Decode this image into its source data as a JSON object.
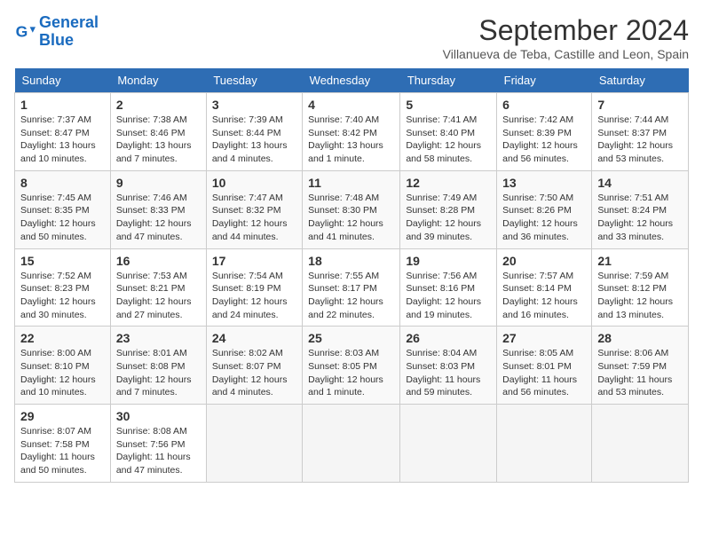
{
  "header": {
    "logo_line1": "General",
    "logo_line2": "Blue",
    "month_title": "September 2024",
    "location": "Villanueva de Teba, Castille and Leon, Spain"
  },
  "columns": [
    "Sunday",
    "Monday",
    "Tuesday",
    "Wednesday",
    "Thursday",
    "Friday",
    "Saturday"
  ],
  "weeks": [
    [
      {
        "day": "1",
        "sunrise": "7:37 AM",
        "sunset": "8:47 PM",
        "daylight": "13 hours and 10 minutes."
      },
      {
        "day": "2",
        "sunrise": "7:38 AM",
        "sunset": "8:46 PM",
        "daylight": "13 hours and 7 minutes."
      },
      {
        "day": "3",
        "sunrise": "7:39 AM",
        "sunset": "8:44 PM",
        "daylight": "13 hours and 4 minutes."
      },
      {
        "day": "4",
        "sunrise": "7:40 AM",
        "sunset": "8:42 PM",
        "daylight": "13 hours and 1 minute."
      },
      {
        "day": "5",
        "sunrise": "7:41 AM",
        "sunset": "8:40 PM",
        "daylight": "12 hours and 58 minutes."
      },
      {
        "day": "6",
        "sunrise": "7:42 AM",
        "sunset": "8:39 PM",
        "daylight": "12 hours and 56 minutes."
      },
      {
        "day": "7",
        "sunrise": "7:44 AM",
        "sunset": "8:37 PM",
        "daylight": "12 hours and 53 minutes."
      }
    ],
    [
      {
        "day": "8",
        "sunrise": "7:45 AM",
        "sunset": "8:35 PM",
        "daylight": "12 hours and 50 minutes."
      },
      {
        "day": "9",
        "sunrise": "7:46 AM",
        "sunset": "8:33 PM",
        "daylight": "12 hours and 47 minutes."
      },
      {
        "day": "10",
        "sunrise": "7:47 AM",
        "sunset": "8:32 PM",
        "daylight": "12 hours and 44 minutes."
      },
      {
        "day": "11",
        "sunrise": "7:48 AM",
        "sunset": "8:30 PM",
        "daylight": "12 hours and 41 minutes."
      },
      {
        "day": "12",
        "sunrise": "7:49 AM",
        "sunset": "8:28 PM",
        "daylight": "12 hours and 39 minutes."
      },
      {
        "day": "13",
        "sunrise": "7:50 AM",
        "sunset": "8:26 PM",
        "daylight": "12 hours and 36 minutes."
      },
      {
        "day": "14",
        "sunrise": "7:51 AM",
        "sunset": "8:24 PM",
        "daylight": "12 hours and 33 minutes."
      }
    ],
    [
      {
        "day": "15",
        "sunrise": "7:52 AM",
        "sunset": "8:23 PM",
        "daylight": "12 hours and 30 minutes."
      },
      {
        "day": "16",
        "sunrise": "7:53 AM",
        "sunset": "8:21 PM",
        "daylight": "12 hours and 27 minutes."
      },
      {
        "day": "17",
        "sunrise": "7:54 AM",
        "sunset": "8:19 PM",
        "daylight": "12 hours and 24 minutes."
      },
      {
        "day": "18",
        "sunrise": "7:55 AM",
        "sunset": "8:17 PM",
        "daylight": "12 hours and 22 minutes."
      },
      {
        "day": "19",
        "sunrise": "7:56 AM",
        "sunset": "8:16 PM",
        "daylight": "12 hours and 19 minutes."
      },
      {
        "day": "20",
        "sunrise": "7:57 AM",
        "sunset": "8:14 PM",
        "daylight": "12 hours and 16 minutes."
      },
      {
        "day": "21",
        "sunrise": "7:59 AM",
        "sunset": "8:12 PM",
        "daylight": "12 hours and 13 minutes."
      }
    ],
    [
      {
        "day": "22",
        "sunrise": "8:00 AM",
        "sunset": "8:10 PM",
        "daylight": "12 hours and 10 minutes."
      },
      {
        "day": "23",
        "sunrise": "8:01 AM",
        "sunset": "8:08 PM",
        "daylight": "12 hours and 7 minutes."
      },
      {
        "day": "24",
        "sunrise": "8:02 AM",
        "sunset": "8:07 PM",
        "daylight": "12 hours and 4 minutes."
      },
      {
        "day": "25",
        "sunrise": "8:03 AM",
        "sunset": "8:05 PM",
        "daylight": "12 hours and 1 minute."
      },
      {
        "day": "26",
        "sunrise": "8:04 AM",
        "sunset": "8:03 PM",
        "daylight": "11 hours and 59 minutes."
      },
      {
        "day": "27",
        "sunrise": "8:05 AM",
        "sunset": "8:01 PM",
        "daylight": "11 hours and 56 minutes."
      },
      {
        "day": "28",
        "sunrise": "8:06 AM",
        "sunset": "7:59 PM",
        "daylight": "11 hours and 53 minutes."
      }
    ],
    [
      {
        "day": "29",
        "sunrise": "8:07 AM",
        "sunset": "7:58 PM",
        "daylight": "11 hours and 50 minutes."
      },
      {
        "day": "30",
        "sunrise": "8:08 AM",
        "sunset": "7:56 PM",
        "daylight": "11 hours and 47 minutes."
      },
      null,
      null,
      null,
      null,
      null
    ]
  ],
  "labels": {
    "sunrise": "Sunrise:",
    "sunset": "Sunset:",
    "daylight": "Daylight:"
  }
}
